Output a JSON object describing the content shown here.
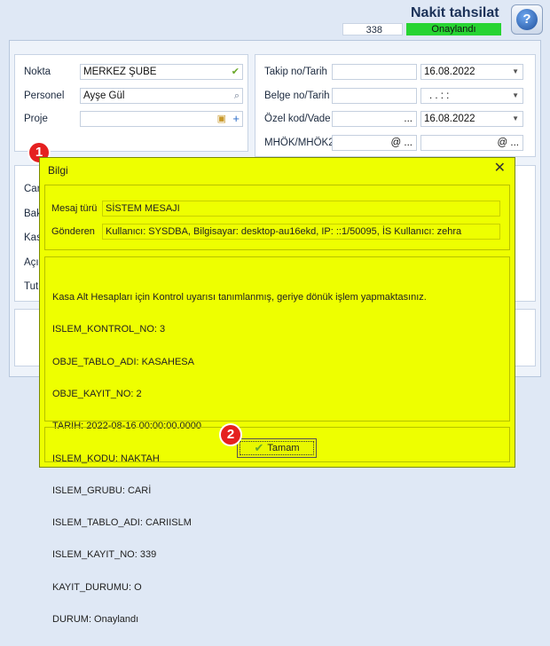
{
  "header": {
    "title": "Nakit tahsilat",
    "record_count": "338",
    "status": "Onaylandı",
    "help_icon": "question-icon"
  },
  "left_group": {
    "rows": [
      {
        "label": "Nokta",
        "value": "MERKEZ ŞUBE",
        "icon": "check-icon"
      },
      {
        "label": "Personel",
        "value": "Ayşe Gül",
        "icon": "lookup-icon"
      },
      {
        "label": "Proje",
        "value": "",
        "icon": "lock-plus-icon"
      }
    ]
  },
  "right_group": {
    "rows": [
      {
        "label": "Takip no/Tarih",
        "value1": "",
        "value2": "16.08.2022"
      },
      {
        "label": "Belge no/Tarih",
        "value1": "",
        "value2": ". .   : :"
      },
      {
        "label": "Özel kod/Vade",
        "value1": "...",
        "value2": "16.08.2022"
      },
      {
        "label": "MHÖK/MHÖK2",
        "value1": "@ ...",
        "value2": "@ ..."
      }
    ]
  },
  "hidden_labels": [
    "Car",
    "Bak",
    "Kas",
    "Açık",
    "Tut"
  ],
  "dialog": {
    "title": "Bilgi",
    "close": "✕",
    "message_type_label": "Mesaj türü",
    "message_type_value": "SİSTEM MESAJI",
    "sender_label": "Gönderen",
    "sender_value": "Kullanıcı: SYSDBA, Bilgisayar: desktop-au16ekd, IP: ::1/50095, İS Kullanıcı: zehra",
    "lines": [
      "Kasa Alt Hesapları için Kontrol uyarısı tanımlanmış, geriye dönük işlem yapmaktasınız.",
      "ISLEM_KONTROL_NO: 3",
      "OBJE_TABLO_ADI: KASAHESA",
      "OBJE_KAYIT_NO: 2",
      "TARIH: 2022-08-16 00:00:00.0000",
      "ISLEM_KODU: NAKTAH",
      "ISLEM_GRUBU: CARİ",
      "ISLEM_TABLO_ADI: CARIISLM",
      "ISLEM_KAYIT_NO: 339",
      "KAYIT_DURUMU: O",
      "DURUM: Onaylandı"
    ],
    "ok_label": "Tamam"
  },
  "steps": {
    "first": "1",
    "second": "2"
  },
  "colors": {
    "dialog_bg": "#eeff00",
    "status_bg": "#27d432",
    "step_marker": "#e52020"
  }
}
